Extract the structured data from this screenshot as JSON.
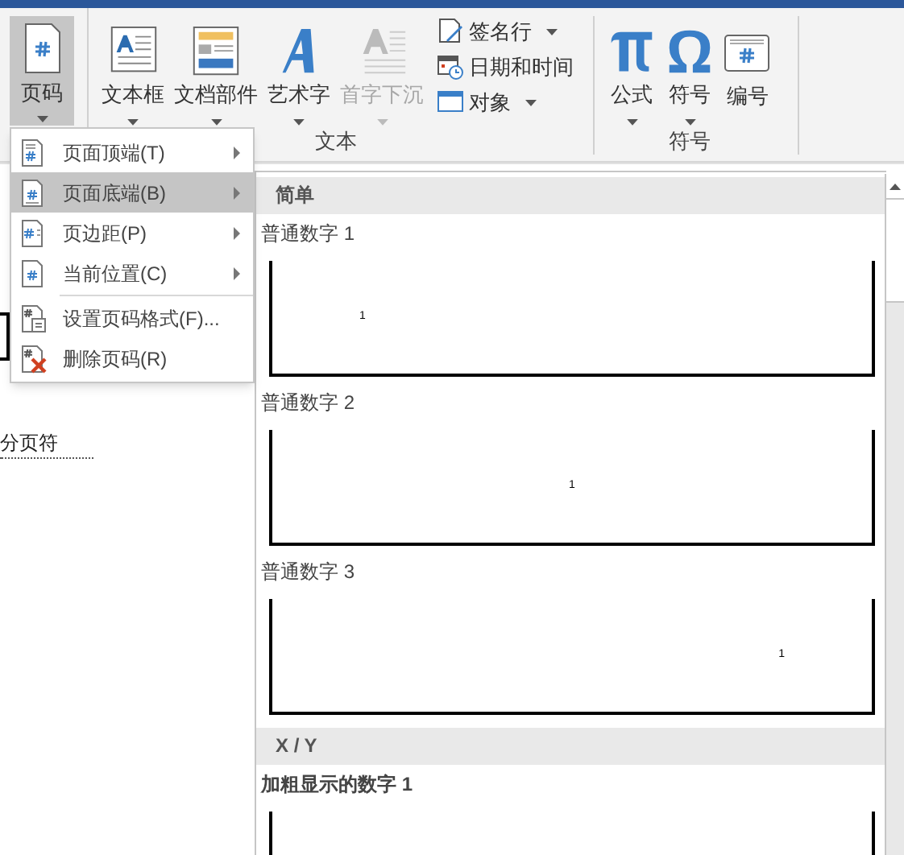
{
  "ribbon": {
    "page_number_button": {
      "label": "页码",
      "pressed": true,
      "dropdown": true
    },
    "groups": [
      {
        "label": "文本",
        "large": [
          {
            "label": "文本框",
            "disabled": false,
            "dropdown": true
          },
          {
            "label": "文档部件",
            "disabled": false,
            "dropdown": true
          },
          {
            "label": "艺术字",
            "disabled": false,
            "dropdown": true
          },
          {
            "label": "首字下沉",
            "disabled": true,
            "dropdown": true
          }
        ],
        "small": [
          {
            "label": "签名行",
            "dropdown": true
          },
          {
            "label": "日期和时间",
            "dropdown": false
          },
          {
            "label": "对象",
            "dropdown": true
          }
        ]
      },
      {
        "label": "符号",
        "large": [
          {
            "label": "公式",
            "disabled": false,
            "dropdown": true
          },
          {
            "label": "符号",
            "disabled": false,
            "dropdown": true
          },
          {
            "label": "编号",
            "disabled": false,
            "dropdown": false
          }
        ]
      }
    ]
  },
  "document": {
    "page_break": "分页符"
  },
  "menu": {
    "items": [
      {
        "label": "页面顶端(T)",
        "selected": false,
        "submenu": true
      },
      {
        "label": "页面底端(B)",
        "selected": true,
        "submenu": true
      },
      {
        "label": "页边距(P)",
        "selected": false,
        "submenu": true
      },
      {
        "label": "当前位置(C)",
        "selected": false,
        "submenu": true
      },
      {
        "label": "设置页码格式(F)...",
        "selected": false,
        "submenu": false
      },
      {
        "label": "删除页码(R)",
        "selected": false,
        "submenu": false
      }
    ]
  },
  "gallery": {
    "sections": [
      {
        "title": "简单",
        "items": [
          {
            "title": "普通数字 1",
            "number": "1"
          },
          {
            "title": "普通数字 2",
            "number": "1"
          },
          {
            "title": "普通数字 3",
            "number": "1"
          }
        ]
      },
      {
        "title": "X / Y",
        "items": [
          {
            "title": "加粗显示的数字 1"
          }
        ]
      }
    ]
  }
}
